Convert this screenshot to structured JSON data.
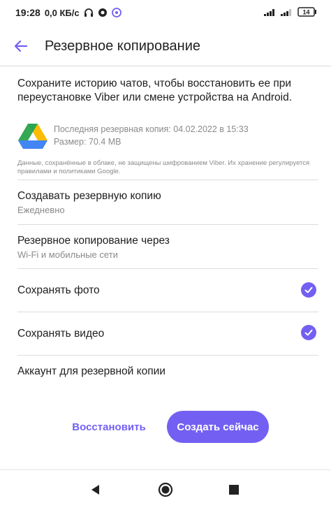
{
  "status": {
    "time": "19:28",
    "speed": "0,0 КБ/с",
    "battery": "14"
  },
  "header": {
    "title": "Резервное копирование"
  },
  "intro": "Сохраните историю чатов, чтобы восстановить ее при переустановке Viber или смене устройства на Android.",
  "backup": {
    "last_backup": "Последняя резервная копия: 04.02.2022 в 15:33",
    "size": "Размер: 70.4 MB"
  },
  "disclaimer": "Данные, сохранённые в облаке, не защищены шифрованием Viber. Их хранение регулируется правилами и политиками Google.",
  "settings": {
    "create_backup": {
      "title": "Создавать резервную копию",
      "value": "Ежедневно"
    },
    "backup_via": {
      "title": "Резервное копирование через",
      "value": "Wi-Fi и мобильные сети"
    },
    "save_photos": {
      "title": "Сохранять фото",
      "checked": true
    },
    "save_videos": {
      "title": "Сохранять видео",
      "checked": true
    },
    "account": {
      "title": "Аккаунт для резервной копии"
    }
  },
  "buttons": {
    "restore": "Восстановить",
    "create_now": "Создать сейчас"
  },
  "colors": {
    "accent": "#7360f2"
  }
}
